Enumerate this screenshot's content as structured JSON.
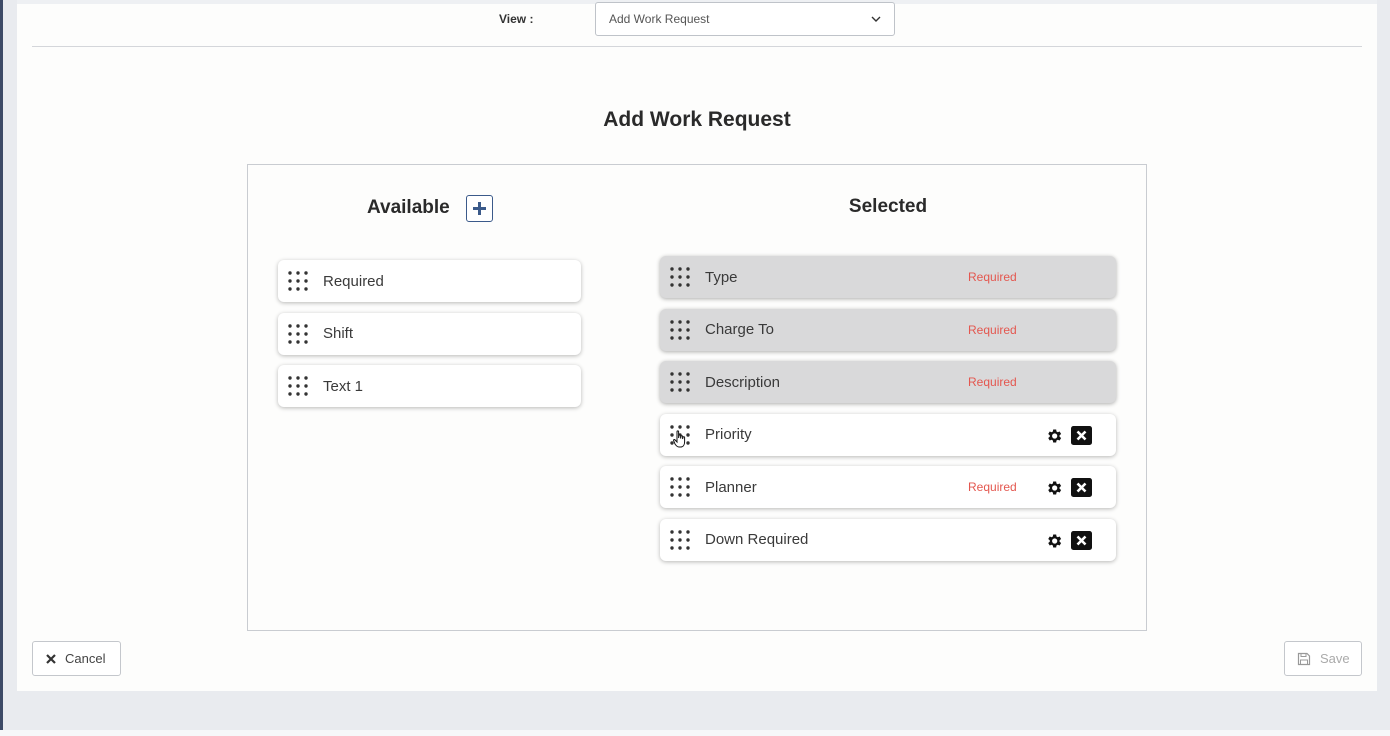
{
  "view": {
    "label": "View :",
    "selected": "Add Work Request"
  },
  "page_title": "Add Work Request",
  "available": {
    "header": "Available",
    "items": [
      {
        "label": "Required"
      },
      {
        "label": "Shift"
      },
      {
        "label": "Text 1"
      }
    ]
  },
  "selected": {
    "header": "Selected",
    "items": [
      {
        "label": "Type",
        "tag": "Required",
        "locked": true
      },
      {
        "label": "Charge To",
        "tag": "Required",
        "locked": true
      },
      {
        "label": "Description",
        "tag": "Required",
        "locked": true
      },
      {
        "label": "Priority",
        "tag": "",
        "locked": false
      },
      {
        "label": "Planner",
        "tag": "Required",
        "locked": false
      },
      {
        "label": "Down Required",
        "tag": "",
        "locked": false
      }
    ]
  },
  "buttons": {
    "cancel": "Cancel",
    "save": "Save"
  },
  "icons": {
    "add": "plus-square-icon",
    "gear": "gear-icon",
    "remove": "close-square-icon",
    "grip": "drag-grip-icon",
    "cancel": "x-icon",
    "save": "floppy-disk-icon",
    "dropdown": "chevron-down-icon"
  },
  "colors": {
    "required_tag": "#e4574f",
    "accent": "#3b5a8a",
    "locked_item_bg": "#d9d9da"
  }
}
